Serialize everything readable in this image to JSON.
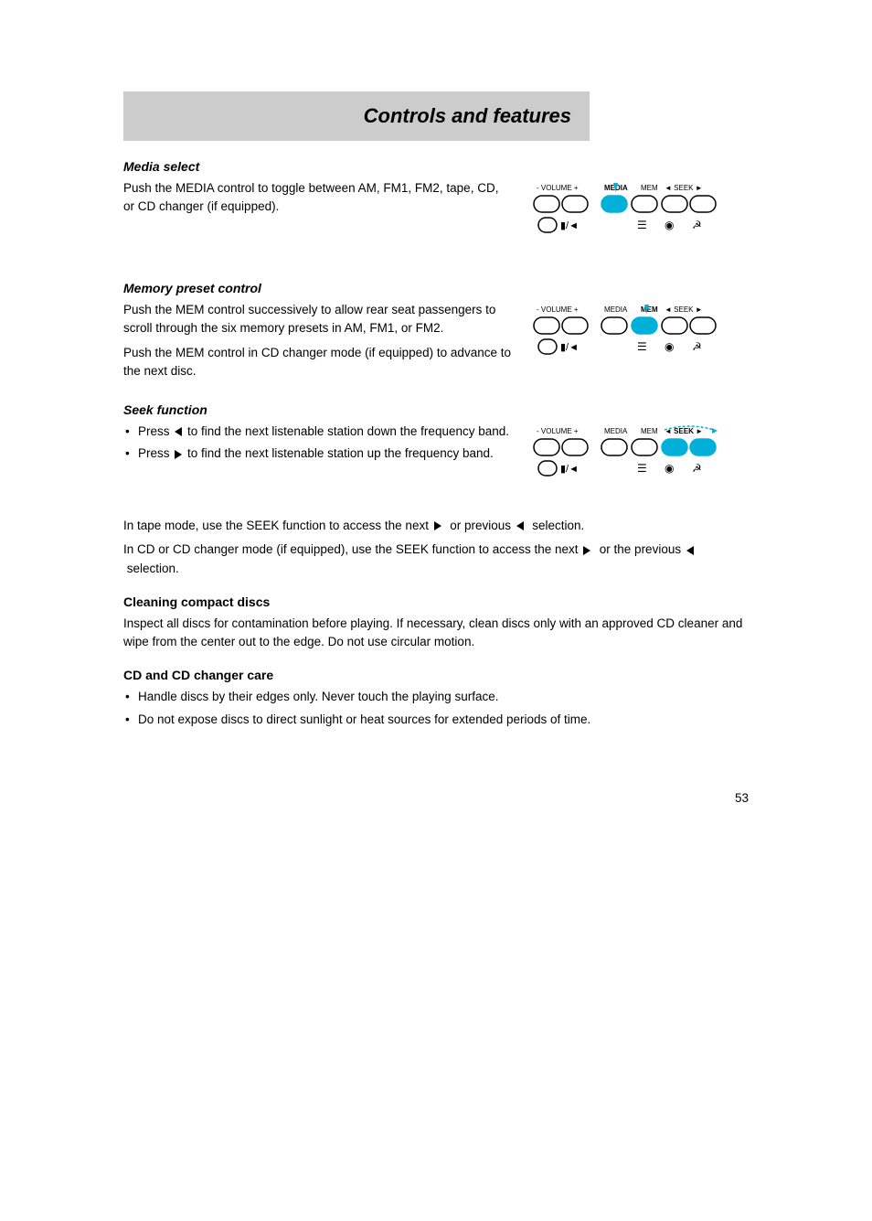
{
  "page": {
    "page_number": "53",
    "header": {
      "title": "Controls and features"
    },
    "sections": [
      {
        "id": "media-select",
        "heading": "Media select",
        "heading_style": "italic",
        "paragraphs": [
          "Push the MEDIA control to toggle between AM, FM1, FM2, tape, CD, or CD changer (if equipped)."
        ]
      },
      {
        "id": "memory-preset",
        "heading": "Memory preset control",
        "heading_style": "italic",
        "paragraphs": [
          "Push the MEM control successively to allow rear seat passengers to scroll through the six memory presets in AM, FM1, or FM2.",
          "Push the MEM control in CD changer mode (if equipped) to advance to the next disc."
        ]
      },
      {
        "id": "seek-function",
        "heading": "Seek function",
        "heading_style": "italic",
        "bullets": [
          "Press ◄  to find the next listenable station down the frequency band.",
          "Press ►  to find the next listenable station up the frequency band."
        ],
        "paragraphs": [
          "In tape mode, use the SEEK function to access the next ►  or previous ◄  selection.",
          "In CD or CD changer mode (if equipped), use the SEEK function to access the next ►  or the previous ◄  selection."
        ]
      },
      {
        "id": "cleaning-compact-discs",
        "heading": "Cleaning compact discs",
        "heading_style": "bold",
        "paragraphs": [
          "Inspect all discs for contamination before playing. If necessary, clean discs only with an approved CD cleaner and wipe from the center out to the edge. Do not use circular motion."
        ]
      },
      {
        "id": "cd-changer-care",
        "heading": "CD and CD changer care",
        "heading_style": "bold",
        "bullets": [
          "Handle discs by their edges only. Never touch the playing surface.",
          "Do not expose discs to direct sunlight or heat sources for extended periods of time."
        ]
      }
    ]
  }
}
